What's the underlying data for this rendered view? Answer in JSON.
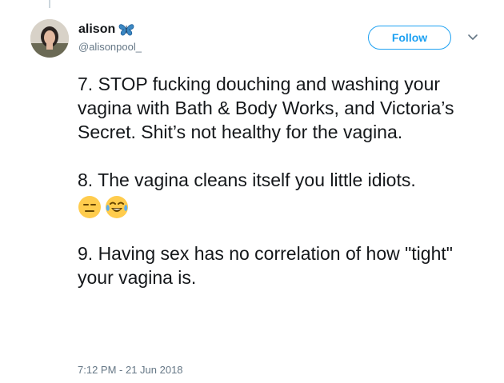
{
  "tweet": {
    "author_name": "alison",
    "author_handle": "@alisonpool_",
    "follow_label": "Follow",
    "paragraphs": [
      "7. STOP fucking douching and washing your vagina with Bath & Body Works, and Victoria’s Secret. Shit’s not healthy for the vagina.",
      "8. The vagina cleans itself you little idiots.",
      "9. Having sex has no correlation of how \"tight\" your vagina is."
    ],
    "timestamp": "7:12 PM - 21 Jun 2018"
  },
  "icons": {
    "name_badge": "butterfly-icon",
    "menu": "chevron-down-icon",
    "emoji_1": "expressionless-face-emoji",
    "emoji_2": "crying-laughing-face-emoji"
  },
  "colors": {
    "accent": "#1da1f2",
    "secondary_text": "#657786",
    "primary_text": "#14171a"
  }
}
